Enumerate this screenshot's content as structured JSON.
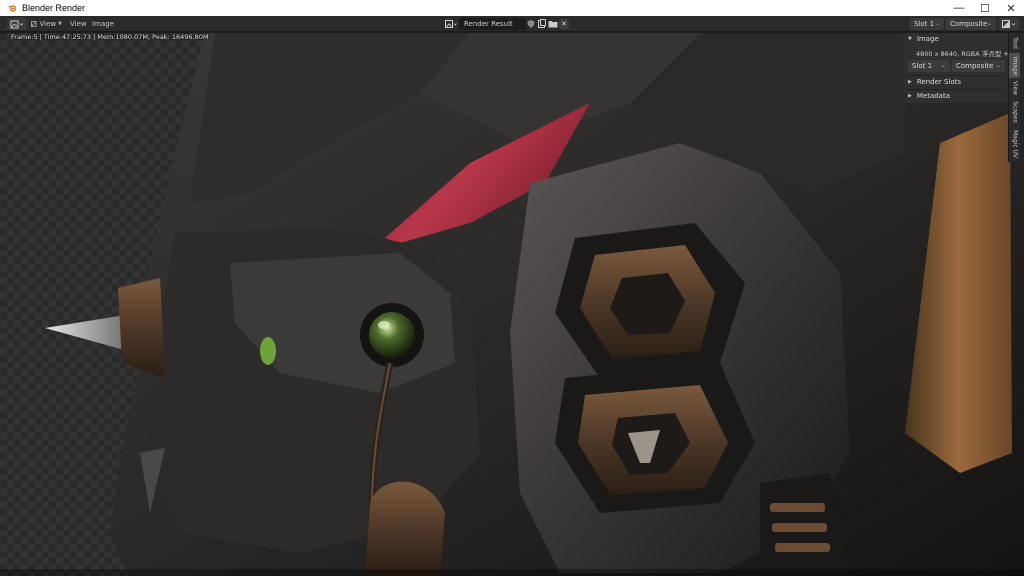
{
  "window": {
    "title": "Blender Render",
    "controls": {
      "minimize": "—",
      "maximize": "☐",
      "close": "✕"
    }
  },
  "header": {
    "menus": [
      "View",
      "View",
      "Image"
    ],
    "image_name": "Render Result",
    "slot": "Slot 1",
    "layer": "Composite"
  },
  "overlay": {
    "stats": "Frame:5 | Time:47:25.73 | Mem:1080.07M, Peak: 16496.80M"
  },
  "sidebar": {
    "image_panel": {
      "title": "Image",
      "info": "4800 x 8640,  RGBA 浮点型 + Z",
      "slot": "Slot 1",
      "layer": "Composite"
    },
    "render_slots": "Render Slots",
    "metadata": "Metadata",
    "tabs": [
      "Tool",
      "Image",
      "View",
      "Scopes",
      "Magic UV"
    ],
    "active_tab": "Image"
  },
  "colors": {
    "accent": "#e87d0d",
    "panel": "#303030",
    "header": "#2b2b2b"
  }
}
